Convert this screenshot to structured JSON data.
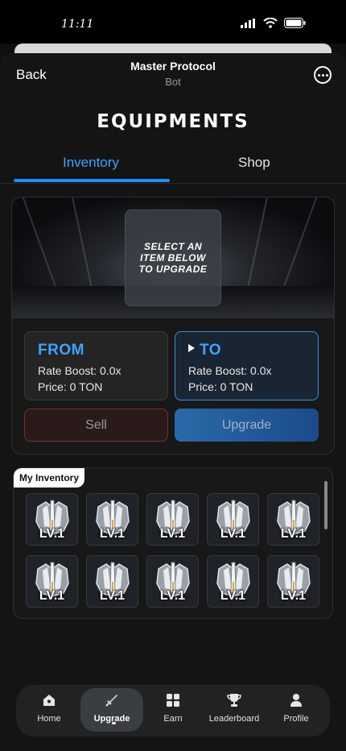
{
  "status": {
    "time": "11:11"
  },
  "header": {
    "back_label": "Back",
    "title": "Master Protocol",
    "subtitle": "Bot"
  },
  "page": {
    "heading": "EQUIPMENTS"
  },
  "tabs": [
    {
      "label": "Inventory",
      "active": true
    },
    {
      "label": "Shop",
      "active": false
    }
  ],
  "upgrade_panel": {
    "banner_text": "SELECT AN ITEM BELOW TO UPGRADE",
    "from": {
      "title": "FROM",
      "rate_boost": "Rate Boost: 0.0x",
      "price": "Price: 0 TON"
    },
    "to": {
      "title": "TO",
      "rate_boost": "Rate Boost: 0.0x",
      "price": "Price: 0 TON"
    },
    "sell_label": "Sell",
    "upgrade_label": "Upgrade"
  },
  "inventory": {
    "tag": "My Inventory",
    "items": [
      {
        "level": "LV.1"
      },
      {
        "level": "LV.1"
      },
      {
        "level": "LV.1"
      },
      {
        "level": "LV.1"
      },
      {
        "level": "LV.1"
      },
      {
        "level": "LV.1"
      },
      {
        "level": "LV.1"
      },
      {
        "level": "LV.1"
      },
      {
        "level": "LV.1"
      },
      {
        "level": "LV.1"
      }
    ]
  },
  "nav": [
    {
      "label": "Home",
      "icon": "home-icon"
    },
    {
      "label": "Upgrade",
      "icon": "sword-icon",
      "active": true
    },
    {
      "label": "Earn",
      "icon": "grid-icon"
    },
    {
      "label": "Leaderboard",
      "icon": "trophy-icon"
    },
    {
      "label": "Profile",
      "icon": "person-icon"
    }
  ],
  "colors": {
    "accent": "#3fa3ff",
    "background": "#141414",
    "sell_border": "#7a2e2e",
    "to_border": "#3b8fe8"
  }
}
